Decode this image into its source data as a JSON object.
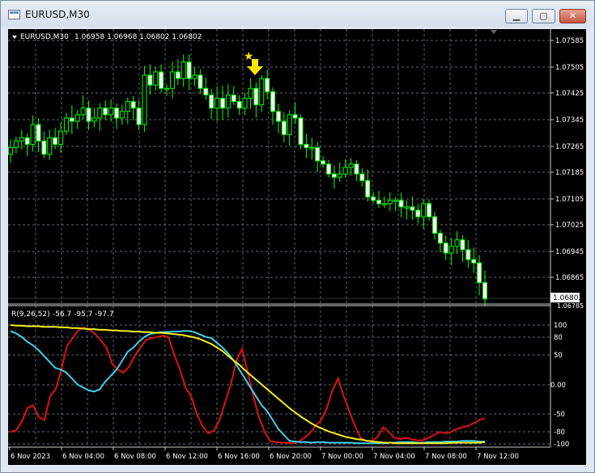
{
  "window": {
    "title": "EURUSD,M30",
    "buttons": {
      "minimize": "▁",
      "maximize": "▢",
      "close": "✕"
    }
  },
  "header": {
    "symbol_label": "EURUSD,M30",
    "ohlc": "1.06958 1.06968 1.06802 1.06802",
    "dropdown_icon": "triangle-down-icon"
  },
  "indicator": {
    "label": "R(9,26,52)",
    "values": "-56.7 -95.7 -97.7"
  },
  "price_axis": {
    "ticks": [
      "1.07585",
      "1.07505",
      "1.07425",
      "1.07345",
      "1.07265",
      "1.07185",
      "1.07105",
      "1.07025",
      "1.06945",
      "1.06865"
    ],
    "current_price": "1.06802",
    "subwindow_top_label": "1.06785"
  },
  "indicator_axis": {
    "ticks": [
      "100",
      "80",
      "50",
      "0.00",
      "-50",
      "-80",
      "-100"
    ]
  },
  "time_axis": {
    "labels": [
      "6 Nov 2023",
      "6 Nov 04:00",
      "6 Nov 08:00",
      "6 Nov 12:00",
      "6 Nov 16:00",
      "6 Nov 20:00",
      "7 Nov 00:00",
      "7 Nov 04:00",
      "7 Nov 08:00",
      "7 Nov 12:00"
    ]
  },
  "colors": {
    "background": "#000000",
    "grid": "#7f8a9a",
    "candle": "#00ff00",
    "price_line": "#ffffff",
    "red_line": "#e01010",
    "cyan_line": "#40d0ea",
    "yellow_line": "#f5ef1a",
    "signal_arrow": "#ffe600"
  },
  "signal": {
    "icons": [
      "star-icon",
      "arrow-down-icon"
    ]
  },
  "chart_data": {
    "type": "candlestick",
    "timeframe": "M30",
    "x": [
      "6 Nov 2023",
      "6 Nov 04:00",
      "6 Nov 08:00",
      "6 Nov 12:00",
      "6 Nov 16:00",
      "6 Nov 20:00",
      "7 Nov 00:00",
      "7 Nov 04:00",
      "7 Nov 08:00",
      "7 Nov 12:00"
    ],
    "ylim": [
      1.06785,
      1.0762
    ],
    "last_close": 1.06802,
    "close_series": [
      1.0726,
      1.0728,
      1.0729,
      1.0727,
      1.0733,
      1.0728,
      1.0724,
      1.0729,
      1.0727,
      1.0731,
      1.0735,
      1.0734,
      1.0736,
      1.0738,
      1.0734,
      1.0735,
      1.0738,
      1.0736,
      1.0738,
      1.0735,
      1.0737,
      1.074,
      1.0738,
      1.0733,
      1.0748,
      1.0745,
      1.0749,
      1.0744,
      1.0744,
      1.0749,
      1.0747,
      1.0752,
      1.0747,
      1.0748,
      1.0744,
      1.0742,
      1.0738,
      1.0741,
      1.0738,
      1.0742,
      1.074,
      1.0738,
      1.0741,
      1.0744,
      1.0739,
      1.0747,
      1.0743,
      1.0737,
      1.0734,
      1.073,
      1.0736,
      1.0735,
      1.0727,
      1.0726,
      1.0726,
      1.0722,
      1.0721,
      1.0718,
      1.0717,
      1.0718,
      1.072,
      1.0721,
      1.0718,
      1.0716,
      1.0711,
      1.071,
      1.0709,
      1.0709,
      1.071,
      1.071,
      1.0708,
      1.0708,
      1.0707,
      1.0705,
      1.0709,
      1.0705,
      1.07,
      1.0697,
      1.0694,
      1.0696,
      1.0698,
      1.0695,
      1.0692,
      1.0691,
      1.0685,
      1.068
    ],
    "series": [
      {
        "values": [
          -80,
          -77,
          -62,
          -40,
          -35,
          -55,
          -60,
          -20,
          -8,
          25,
          65,
          78,
          91,
          96,
          92,
          85,
          74,
          62,
          35,
          25,
          20,
          30,
          48,
          62,
          75,
          78,
          80,
          82,
          79,
          50,
          25,
          -5,
          -20,
          -50,
          -70,
          -82,
          -78,
          -60,
          -30,
          0,
          40,
          60,
          20,
          -20,
          -55,
          -80,
          -95,
          -97,
          -98,
          -98,
          -99,
          -96,
          -90,
          -82,
          -70,
          -60,
          -40,
          -10,
          10,
          -20,
          -45,
          -70,
          -90,
          -95,
          -95,
          -88,
          -72,
          -80,
          -90,
          -92,
          -90,
          -92,
          -94,
          -94,
          -90,
          -85,
          -80,
          -82,
          -80,
          -75,
          -72,
          -70,
          -65,
          -60,
          -57
        ]
      },
      {
        "values": [
          90,
          86,
          80,
          72,
          66,
          58,
          48,
          38,
          28,
          25,
          20,
          10,
          0,
          -5,
          -10,
          -12,
          -8,
          5,
          15,
          25,
          40,
          55,
          62,
          72,
          80,
          85,
          87,
          88,
          88,
          89,
          89,
          90,
          90,
          88,
          84,
          80,
          78,
          70,
          62,
          52,
          40,
          25,
          10,
          -5,
          -20,
          -35,
          -45,
          -60,
          -75,
          -85,
          -95,
          -96,
          -97,
          -97,
          -98,
          -97,
          -97,
          -98,
          -98,
          -98,
          -98,
          -98,
          -99,
          -99,
          -99,
          -99,
          -99,
          -99,
          -98,
          -98,
          -97,
          -97,
          -97,
          -98,
          -98,
          -97,
          -97,
          -97,
          -96,
          -96,
          -96,
          -95,
          -95,
          -95,
          -96,
          -96
        ]
      },
      {
        "values": [
          100,
          99,
          99,
          98,
          98,
          98,
          97,
          97,
          97,
          96,
          96,
          95,
          95,
          94,
          93,
          93,
          92,
          92,
          91,
          91,
          90,
          90,
          89,
          89,
          88,
          88,
          87,
          87,
          86,
          85,
          84,
          83,
          81,
          79,
          76,
          72,
          68,
          62,
          56,
          48,
          40,
          33,
          24,
          16,
          8,
          0,
          -8,
          -16,
          -24,
          -32,
          -40,
          -47,
          -54,
          -60,
          -66,
          -71,
          -75,
          -79,
          -82,
          -85,
          -88,
          -90,
          -92,
          -93,
          -95,
          -96,
          -97,
          -98,
          -98,
          -99,
          -99,
          -99,
          -99,
          -99,
          -99,
          -99,
          -99,
          -99,
          -99,
          -98,
          -98,
          -98,
          -98,
          -98,
          -98,
          -97
        ]
      }
    ]
  }
}
